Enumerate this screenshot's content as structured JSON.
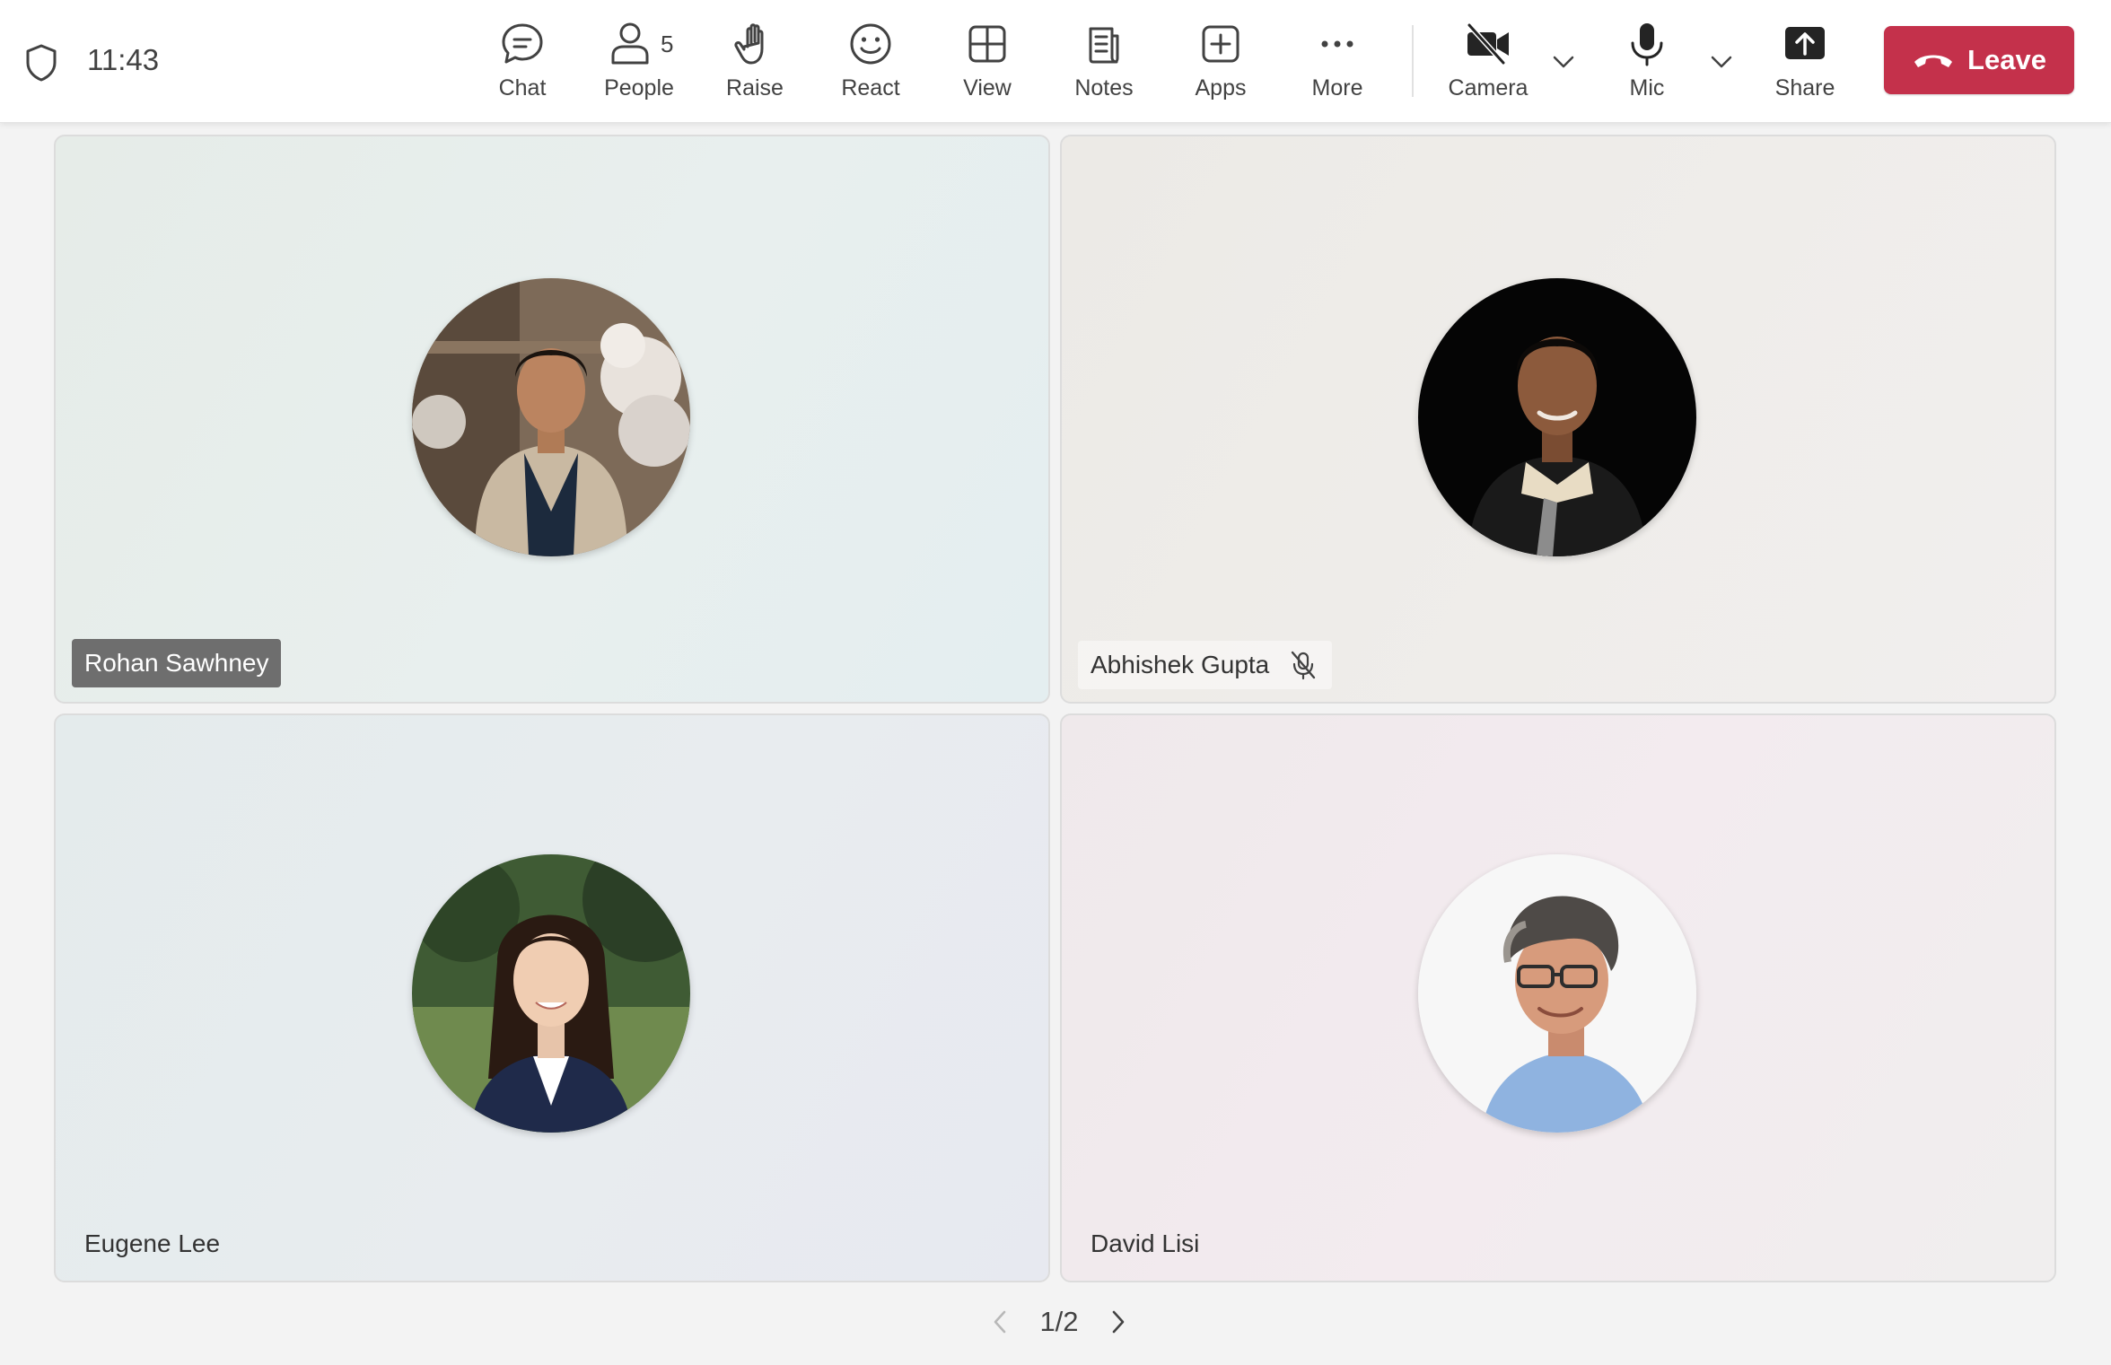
{
  "header": {
    "time": "11:43"
  },
  "toolbar": {
    "chat_label": "Chat",
    "people_label": "People",
    "people_count": "5",
    "raise_label": "Raise",
    "react_label": "React",
    "view_label": "View",
    "notes_label": "Notes",
    "apps_label": "Apps",
    "more_label": "More",
    "camera_label": "Camera",
    "mic_label": "Mic",
    "share_label": "Share",
    "leave_label": "Leave",
    "leave_color": "#c4314b"
  },
  "participants": [
    {
      "name": "Rohan Sawhney",
      "muted": false
    },
    {
      "name": "Abhishek Gupta",
      "muted": true
    },
    {
      "name": "Eugene Lee",
      "muted": false
    },
    {
      "name": "David Lisi",
      "muted": false
    }
  ],
  "pager": {
    "current": "1/2"
  }
}
